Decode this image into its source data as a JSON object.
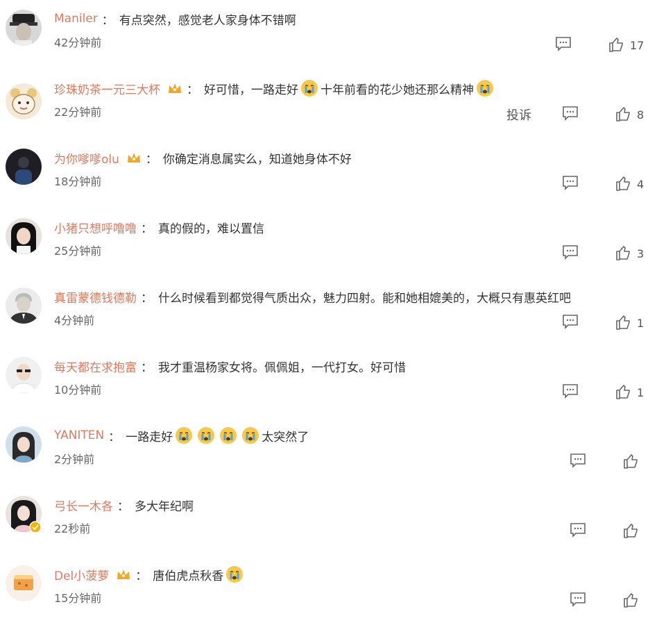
{
  "comments": [
    {
      "user": "Maniler",
      "crown": false,
      "verified": false,
      "text": "有点突然，感觉老人家身体不错啊",
      "time": "42分钟前",
      "likes": "17",
      "report": "",
      "avatar": "dark-hat-man"
    },
    {
      "user": "珍珠奶茶一元三大杯",
      "crown": true,
      "verified": false,
      "text": "好可惜，一路走好",
      "emoji_after": "crying-face-emoji",
      "text2": "十年前看的花少她还那么精神",
      "emoji_end": "crying-face-emoji",
      "time": "22分钟前",
      "likes": "8",
      "report": "投诉",
      "avatar": "cartoon-girl"
    },
    {
      "user": "为你嗲嗲olu",
      "crown": true,
      "verified": false,
      "text": "你确定消息属实么，知道她身体不好",
      "time": "18分钟前",
      "likes": "4",
      "report": "",
      "avatar": "dark-figure"
    },
    {
      "user": "小猪只想呼噜噜",
      "crown": false,
      "verified": false,
      "text": "真的假的，难以置信",
      "time": "25分钟前",
      "likes": "3",
      "report": "",
      "avatar": "woman-black-hair"
    },
    {
      "user": "真雷蒙德钱德勒",
      "crown": false,
      "verified": false,
      "text": "什么时候看到都觉得气质出众，魅力四射。能和她相媲美的，大概只有惠英红吧",
      "time": "4分钟前",
      "likes": "1",
      "report": "",
      "avatar": "old-man-portrait"
    },
    {
      "user": "每天都在求抱富",
      "crown": false,
      "verified": false,
      "text": "我才重温杨家女将。佩佩姐，一代打女。好可惜",
      "time": "10分钟前",
      "likes": "1",
      "report": "",
      "avatar": "person-with-glasses"
    },
    {
      "user": "YANITEN",
      "crown": false,
      "verified": false,
      "text": "一路走好",
      "emojis": 4,
      "text2": "太突然了",
      "time": "2分钟前",
      "likes": "",
      "report": "",
      "avatar": "woman-long-hair"
    },
    {
      "user": "弓长一木各",
      "crown": false,
      "verified": true,
      "text": "多大年纪啊",
      "time": "22秒前",
      "likes": "",
      "report": "",
      "avatar": "girl-portrait"
    },
    {
      "user": "Del小菠萝",
      "crown": true,
      "verified": false,
      "text": "唐伯虎点秋香",
      "emoji_end": "crying-face-emoji",
      "time": "15分钟前",
      "likes": "",
      "report": "",
      "avatar": "orange-cake"
    }
  ],
  "colon": "：",
  "icons": {
    "reply": "comment-icon",
    "like": "thumbs-up-icon",
    "crown": "crown-badge-icon",
    "verified": "verified-badge-icon"
  },
  "colors": {
    "username": "#e07a5f",
    "text": "#333333",
    "meta": "#666666"
  }
}
